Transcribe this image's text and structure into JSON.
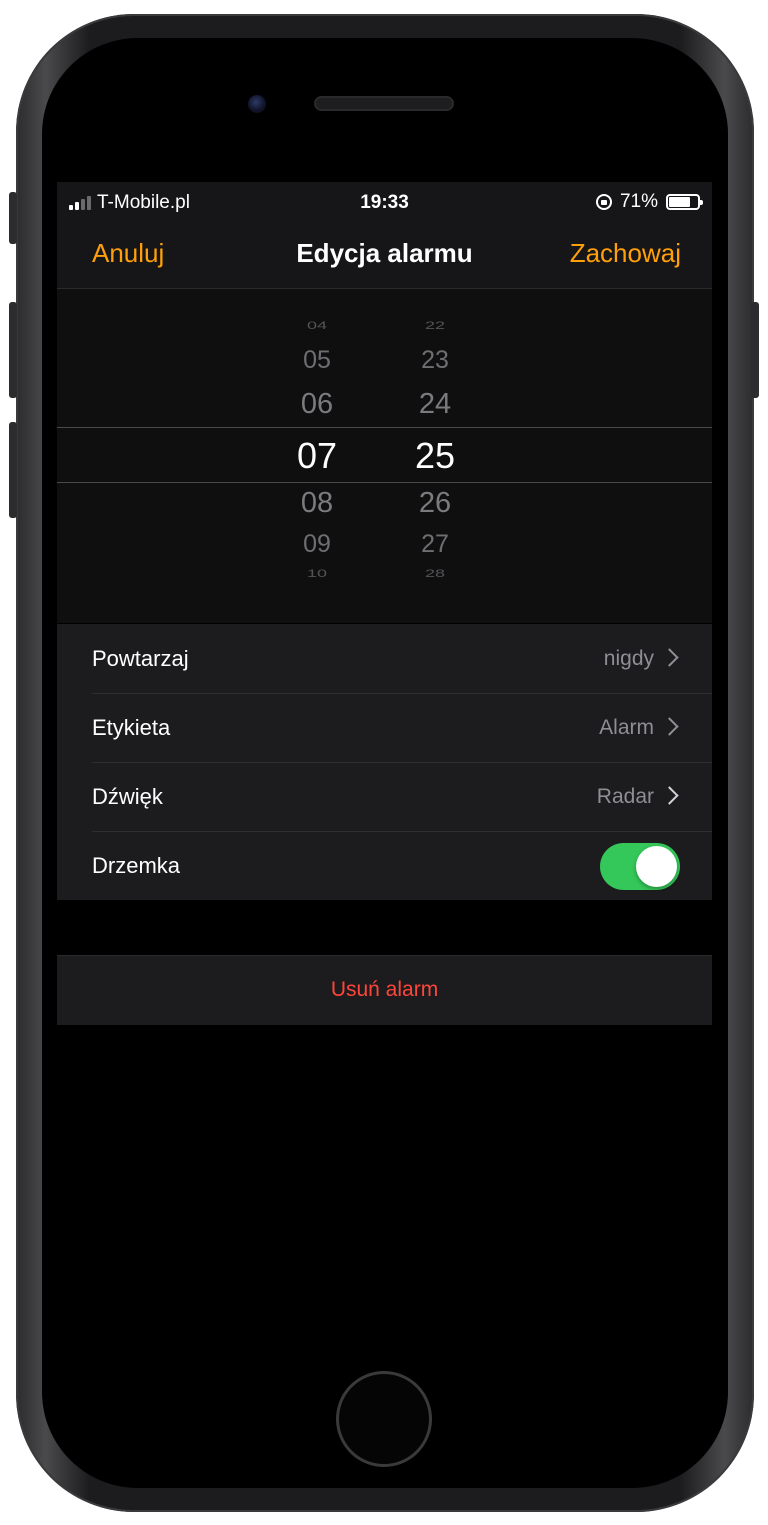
{
  "status_bar": {
    "carrier": "T-Mobile.pl",
    "time": "19:33",
    "battery_percent": "71%",
    "battery_level": 0.71,
    "signal_bars": 4,
    "signal_bars_active": 2
  },
  "nav": {
    "cancel_label": "Anuluj",
    "title": "Edycja alarmu",
    "save_label": "Zachowaj"
  },
  "picker": {
    "hours": [
      "04",
      "05",
      "06",
      "07",
      "08",
      "09",
      "10"
    ],
    "minutes": [
      "22",
      "23",
      "24",
      "25",
      "26",
      "27",
      "28"
    ],
    "selected_hour": "07",
    "selected_minute": "25"
  },
  "settings": {
    "repeat": {
      "label": "Powtarzaj",
      "value": "nigdy"
    },
    "label": {
      "label": "Etykieta",
      "value": "Alarm"
    },
    "sound": {
      "label": "Dźwięk",
      "value": "Radar"
    },
    "snooze": {
      "label": "Drzemka",
      "enabled": true
    }
  },
  "delete_label": "Usuń alarm",
  "colors": {
    "accent": "#ff9f0a",
    "toggle_on": "#34c759",
    "destructive": "#ff453a",
    "background": "#000000",
    "cell": "#1c1c1e",
    "secondary_text": "#8e8e93"
  }
}
